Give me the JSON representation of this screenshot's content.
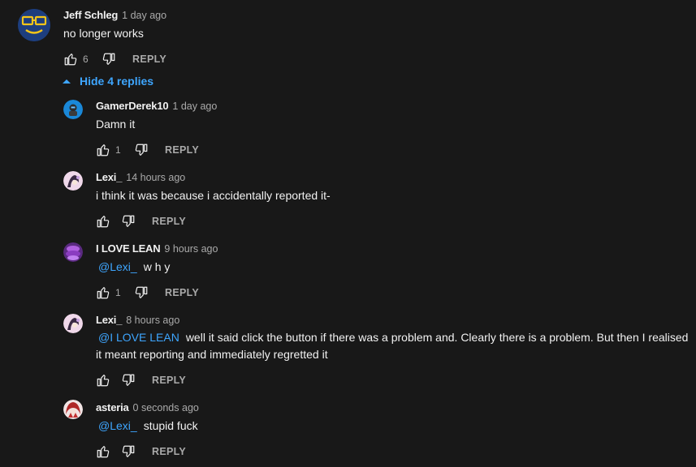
{
  "top_comment": {
    "author": "Jeff Schleg",
    "time": "1 day ago",
    "text": "no longer works",
    "likes": "6",
    "reply_label": "REPLY"
  },
  "toggle": {
    "label": "Hide 4 replies",
    "icon": "caret-up-icon"
  },
  "replies": [
    {
      "author": "GamerDerek10",
      "time": "1 day ago",
      "mention": "",
      "text": "Damn it",
      "likes": "1",
      "reply_label": "REPLY"
    },
    {
      "author": "Lexi_",
      "time": "14 hours ago",
      "mention": "",
      "text": "i think it was because i accidentally reported it-",
      "likes": "",
      "reply_label": "REPLY"
    },
    {
      "author": "I LOVE LEAN",
      "time": "9 hours ago",
      "mention": "@Lexi_",
      "text": "w h y",
      "likes": "1",
      "reply_label": "REPLY"
    },
    {
      "author": "Lexi_",
      "time": "8 hours ago",
      "mention": "@I LOVE LEAN",
      "text": "well it said click the button if there was a problem and. Clearly there is a problem. But then I realised it meant reporting and immediately regretted it",
      "likes": "",
      "reply_label": "REPLY"
    },
    {
      "author": "asteria",
      "time": "0 seconds ago",
      "mention": "@Lexi_",
      "text": "stupid fuck",
      "likes": "",
      "reply_label": "REPLY"
    }
  ],
  "colors": {
    "background": "#181818",
    "link": "#3ea6ff",
    "secondary_text": "#aaaaaa"
  }
}
